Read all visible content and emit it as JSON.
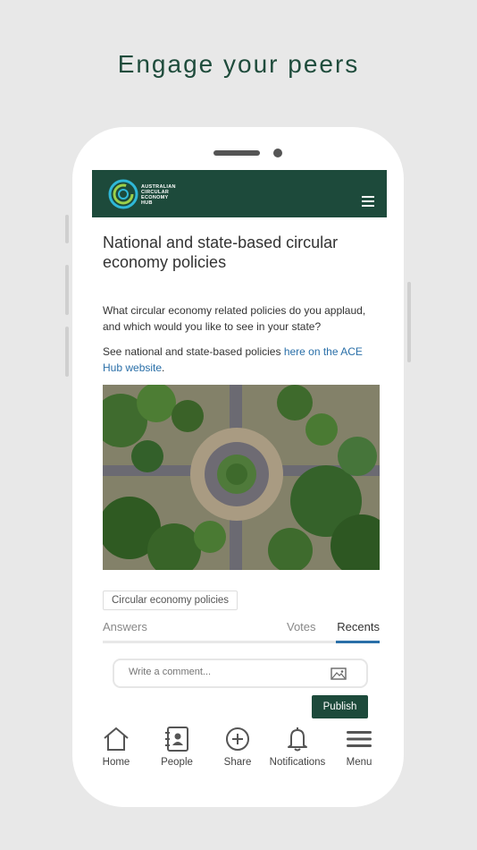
{
  "headline": "Engage your peers",
  "app": {
    "logo_text": [
      "AUSTRALIAN",
      "CIRCULAR",
      "ECONOMY",
      "HUB"
    ]
  },
  "post": {
    "title": "National and state-based circular economy policies",
    "question": "What circular economy related policies do you applaud, and which would you like to see in your state?",
    "see_prefix": "See national and state-based policies ",
    "see_link": "here on the ACE Hub website",
    "see_suffix": ".",
    "tag": "Circular economy policies"
  },
  "tabs": {
    "answers": "Answers",
    "votes": "Votes",
    "recents": "Recents",
    "active": "Recents"
  },
  "comment": {
    "placeholder": "Write a comment...",
    "publish_label": "Publish"
  },
  "nav": {
    "items": [
      {
        "label": "Home",
        "icon": "home-icon"
      },
      {
        "label": "People",
        "icon": "contacts-icon"
      },
      {
        "label": "Share",
        "icon": "plus-circle-icon"
      },
      {
        "label": "Notifications",
        "icon": "bell-icon"
      },
      {
        "label": "Menu",
        "icon": "menu-icon"
      }
    ]
  },
  "colors": {
    "brand_green": "#1d4a3b",
    "link_blue": "#2a6fa8",
    "headline_green": "#1f4c3c"
  }
}
